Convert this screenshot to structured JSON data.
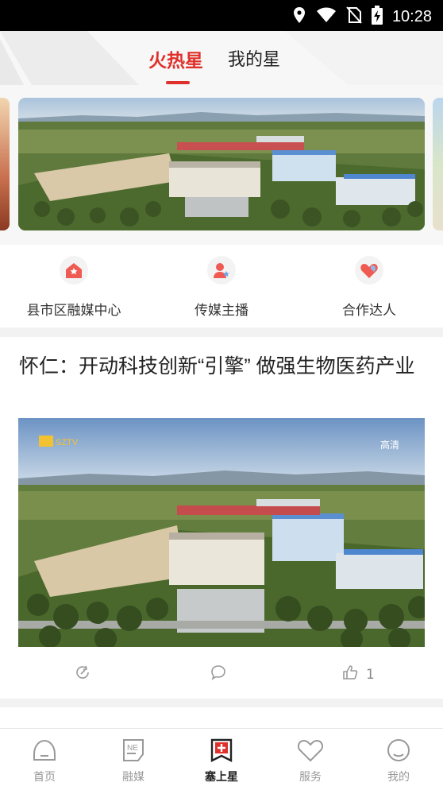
{
  "status_bar": {
    "time": "10:28",
    "icons": [
      "location-icon",
      "wifi-icon",
      "no-sim-icon",
      "battery-charging-icon"
    ]
  },
  "header": {
    "tabs": [
      {
        "label": "火热星",
        "active": true
      },
      {
        "label": "我的星",
        "active": false
      }
    ]
  },
  "categories": [
    {
      "label": "县市区融媒中心",
      "icon": "media-center-icon"
    },
    {
      "label": "传媒主播",
      "icon": "anchor-icon"
    },
    {
      "label": "合作达人",
      "icon": "partner-heart-icon"
    }
  ],
  "article": {
    "title": "怀仁：开动科技创新“引擎” 做强生物医药产业",
    "image_watermark_left": "SZTV",
    "image_watermark_right": "高清",
    "actions": {
      "share_icon": "share-icon",
      "comment_icon": "comment-icon",
      "like_icon": "thumbs-up-icon",
      "like_count": "1"
    }
  },
  "bottom_nav": [
    {
      "label": "首页",
      "icon": "home-icon",
      "active": false
    },
    {
      "label": "融媒",
      "icon": "news-icon",
      "active": false
    },
    {
      "label": "塞上星",
      "icon": "star-bookmark-icon",
      "active": true
    },
    {
      "label": "服务",
      "icon": "heart-service-icon",
      "active": false
    },
    {
      "label": "我的",
      "icon": "profile-icon",
      "active": false
    }
  ],
  "colors": {
    "accent": "#e0302b",
    "inactive_text": "#999999"
  }
}
